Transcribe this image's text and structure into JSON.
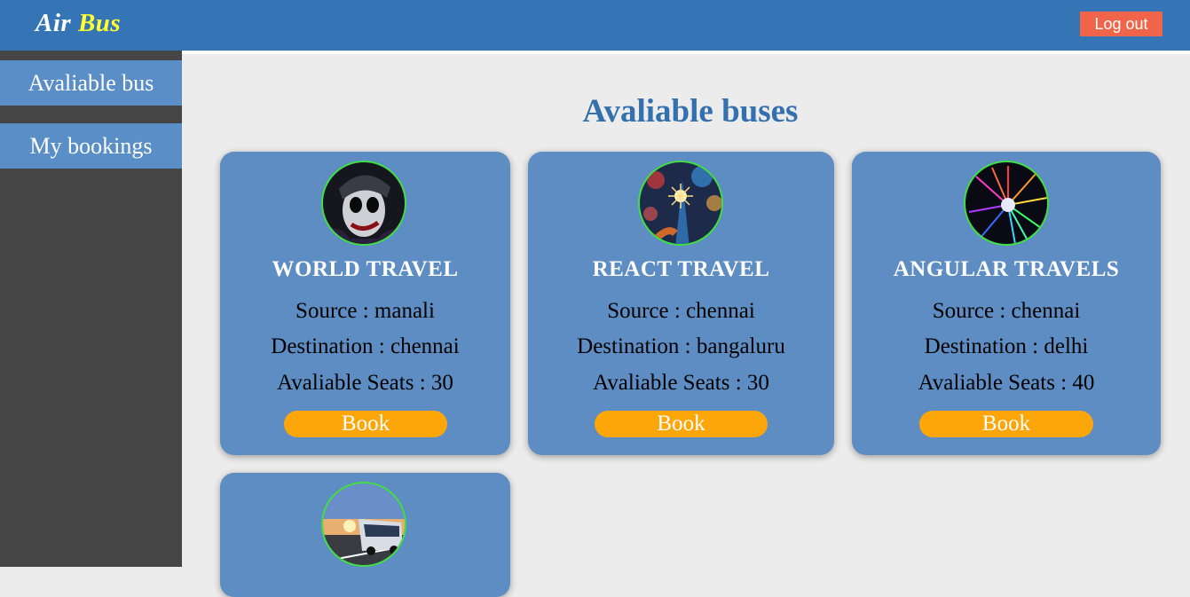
{
  "header": {
    "brand_part1": "Air",
    "brand_part2": "Bus",
    "logout_label": "Log out"
  },
  "sidebar": {
    "items": [
      {
        "label": "Avaliable bus"
      },
      {
        "label": "My bookings"
      }
    ]
  },
  "main": {
    "title": "Avaliable buses",
    "cards": [
      {
        "name": "WORLD TRAVEL",
        "source": "Source : manali",
        "destination": "Destination : chennai",
        "seats": "Avaliable Seats : 30",
        "book_label": "Book",
        "image": "joker-portrait"
      },
      {
        "name": "REACT TRAVEL",
        "source": "Source : chennai",
        "destination": "Destination : bangaluru",
        "seats": "Avaliable Seats : 30",
        "book_label": "Book",
        "image": "sparkler-bokeh"
      },
      {
        "name": "ANGULAR TRAVELS",
        "source": "Source : chennai",
        "destination": "Destination : delhi",
        "seats": "Avaliable Seats : 40",
        "book_label": "Book",
        "image": "neon-light-burst"
      },
      {
        "image": "bus-on-road"
      }
    ]
  },
  "colors": {
    "header_bg": "#3675b5",
    "sidebar_bg": "#464545",
    "sidebar_item_bg": "#5a8ec7",
    "card_bg": "#5d8dc2",
    "book_bg": "#fda60a",
    "logout_bg": "#f0654a",
    "title_color": "#3470ad",
    "brand_accent": "#ffff33",
    "avatar_border": "#3fe03f"
  }
}
